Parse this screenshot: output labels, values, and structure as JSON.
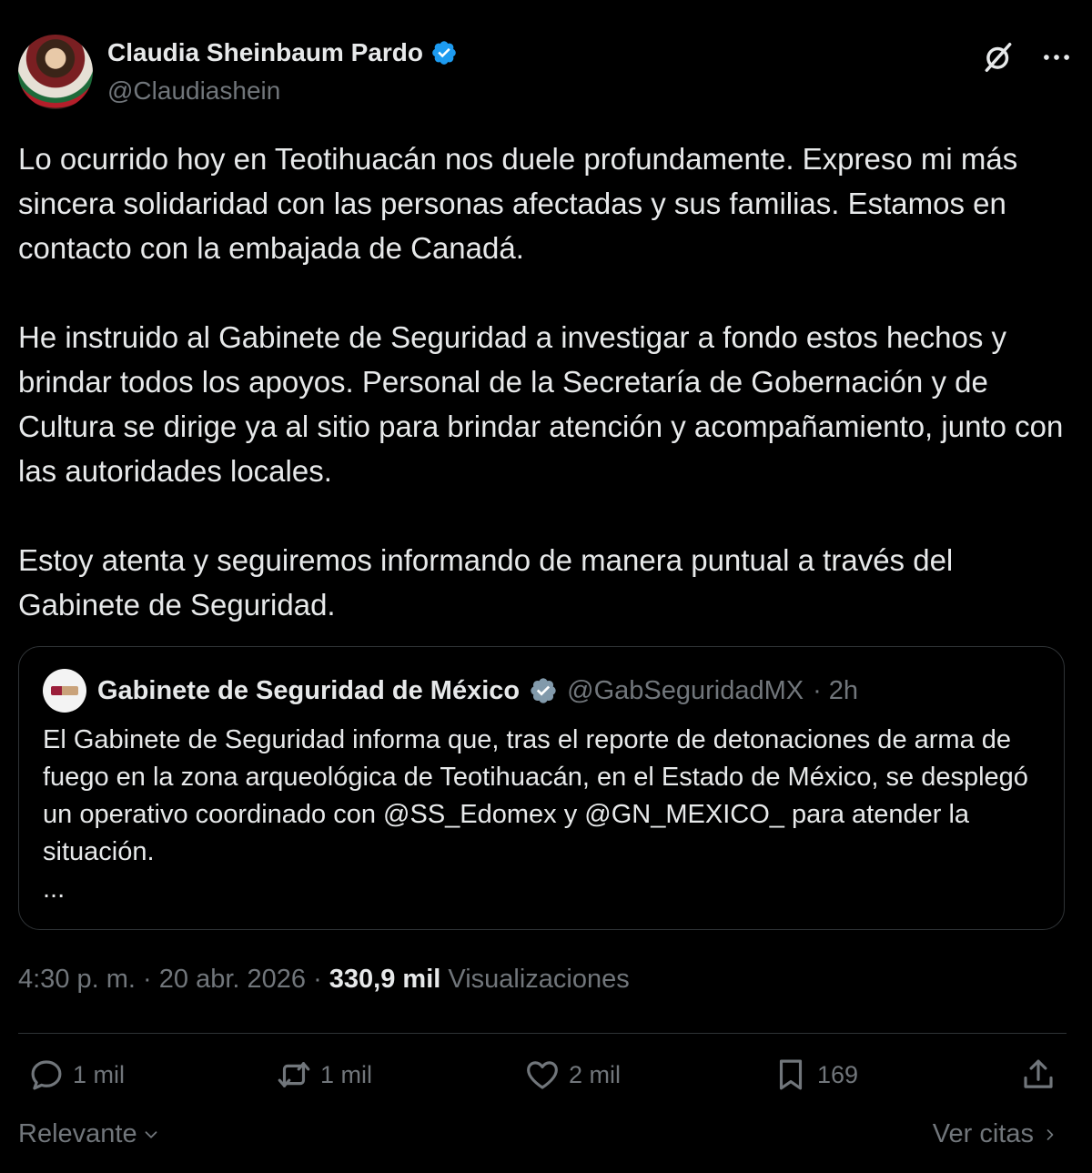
{
  "author": {
    "name": "Claudia Sheinbaum Pardo",
    "handle": "@Claudiashein",
    "verified": true
  },
  "tweet": {
    "paragraphs": [
      "Lo ocurrido hoy en Teotihuacán nos duele profundamente. Expreso mi más sincera solidaridad con las personas afectadas y sus familias. Estamos en contacto con la embajada de Canadá.",
      "He instruido al Gabinete de Seguridad a investigar a fondo estos hechos y brindar todos los apoyos. Personal de la Secretaría de Gobernación y de Cultura se dirige ya al sitio para brindar atención y acompañamiento, junto con las autoridades locales.",
      "Estoy atenta y seguiremos informando de manera puntual a través del Gabinete de Seguridad."
    ]
  },
  "quoted": {
    "name": "Gabinete de Seguridad de México",
    "handle": "@GabSeguridadMX",
    "time": "· 2h",
    "text": "El Gabinete de Seguridad informa que, tras el reporte de detonaciones de arma de fuego en la zona arqueológica de Teotihuacán, en el Estado de México, se desplegó un operativo coordinado con @SS_Edomex y @GN_MEXICO_ para atender la situación.",
    "more": "..."
  },
  "meta": {
    "time": "4:30 p. m.",
    "sep1": " · ",
    "date": "20 abr. 2026",
    "sep2": " · ",
    "views_count": "330,9 mil",
    "views_label": "Visualizaciones"
  },
  "actions": {
    "replies": "1 mil",
    "reposts": "1 mil",
    "likes": "2 mil",
    "bookmarks": "169"
  },
  "footer": {
    "sort_label": "Relevante",
    "quotes_label": "Ver citas"
  },
  "colors": {
    "background": "#000000",
    "text": "#e7e9ea",
    "muted": "#71767b",
    "border": "#2f3336",
    "verified": "#1d9bf0"
  }
}
